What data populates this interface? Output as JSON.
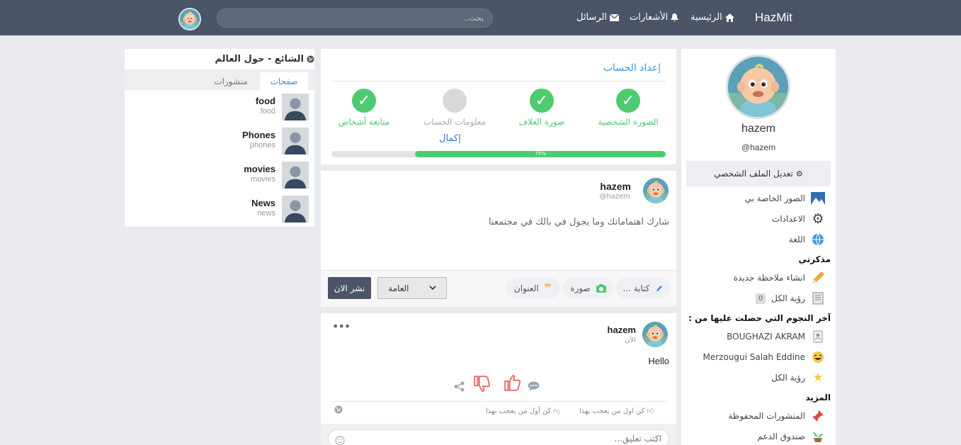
{
  "nav": {
    "brand": "HazMit",
    "home": "الرئيسية",
    "notifications": "الأشعارات",
    "messages": "الرسائل",
    "search_placeholder": "بحث.."
  },
  "trending": {
    "title": "الشائع - حول العالم",
    "tabs": [
      "صفحات",
      "منشورات"
    ],
    "items": [
      {
        "name": "food",
        "sub": "food"
      },
      {
        "name": "Phones",
        "sub": "phones"
      },
      {
        "name": "movies",
        "sub": "movies"
      },
      {
        "name": "News",
        "sub": "news"
      }
    ]
  },
  "setup": {
    "title": "إعداد الحساب",
    "steps": [
      {
        "label": "الصورة الشخصية",
        "done": true
      },
      {
        "label": "صورة الغلاف",
        "done": true
      },
      {
        "label": "معلومات الحساب",
        "done": false
      },
      {
        "label": "متابعة أشخاص",
        "done": true
      }
    ],
    "complete_link": "إكمال",
    "progress_label": "75%",
    "progress_percent": 75
  },
  "composer": {
    "user_name": "hazem",
    "user_handle": "@hazem",
    "placeholder": "شارك اهتماماتك وما يجول في بالك في مجتمعنا",
    "write_label": "كتابة ...",
    "photo_label": "صورة",
    "title_label": "العنوان",
    "privacy_value": "العامة",
    "publish_label": "نشر الان"
  },
  "post": {
    "user_name": "hazem",
    "time": "الآن",
    "text": "Hello",
    "like_meta": "كن اول من يعجب بهذا",
    "dislike_meta": "كن أول من يعجب بهذا",
    "comment_placeholder": "اكتب تعليق..."
  },
  "profile": {
    "name": "hazem",
    "handle": "@hazem",
    "edit_label": "تعديل الملف الشخصي",
    "menu": [
      "الصور الخاصة بي",
      "الاعدادات",
      "اللغة"
    ],
    "notes_title": "مذكرتي",
    "notes": [
      "انشاء ملاحظة جديدة",
      "رؤية الكل"
    ],
    "notes_count": "0",
    "stars_title": "آخر النجوم التي حصلت عليها من :",
    "stars": [
      "BOUGHAZI AKRAM",
      "Merzougui Salah Eddine",
      "رؤية الكل"
    ],
    "more_title": "المزيد",
    "more": [
      "المنشورات المحفوظة",
      "صندوق الدعم"
    ]
  },
  "colors": {
    "topbar": "#4b5567",
    "accent_green": "#4ecb71",
    "link_blue": "#3a9ad9",
    "dislike_red": "#f06a6a"
  }
}
